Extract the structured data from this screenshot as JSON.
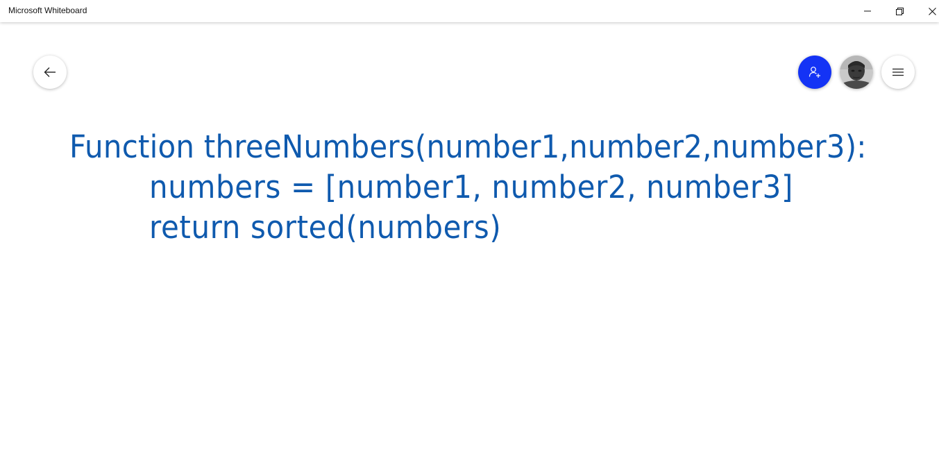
{
  "window": {
    "title": "Microsoft Whiteboard",
    "controls": {
      "minimize_icon": "minimize-icon",
      "restore_icon": "restore-icon",
      "close_icon": "close-icon"
    }
  },
  "toolbar": {
    "back_icon": "arrow-left-icon",
    "invite_icon": "add-person-icon",
    "menu_icon": "hamburger-menu-icon",
    "invite_color": "#1433f5"
  },
  "board": {
    "ink_color": "#0f5aae",
    "lines": [
      "Function threeNumbers(number1,number2,number3):",
      "numbers = [number1, number2, number3]",
      "return sorted(numbers)"
    ]
  }
}
